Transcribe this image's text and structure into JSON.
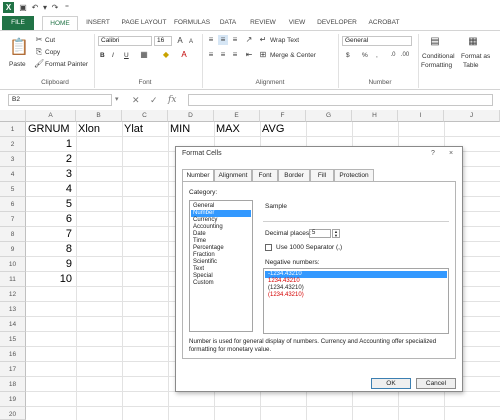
{
  "titlebar": {
    "app_icon": "X",
    "save_icon": "save-icon",
    "undo_icon": "undo-icon",
    "redo_icon": "redo-icon"
  },
  "ribbon_tabs": [
    "FILE",
    "HOME",
    "INSERT",
    "PAGE LAYOUT",
    "FORMULAS",
    "DATA",
    "REVIEW",
    "VIEW",
    "DEVELOPER",
    "ACROBAT"
  ],
  "ribbon": {
    "clipboard": {
      "paste": "Paste",
      "cut": "Cut",
      "copy": "Copy",
      "format_painter": "Format Painter",
      "label": "Clipboard"
    },
    "font": {
      "name": "Calibri",
      "size": "16",
      "bold": "B",
      "italic": "I",
      "underline": "U",
      "label": "Font"
    },
    "alignment": {
      "wrap_text": "Wrap Text",
      "merge_center": "Merge & Center",
      "label": "Alignment"
    },
    "number": {
      "format": "General",
      "currency": "$",
      "percent": "%",
      "comma": ",",
      "label": "Number"
    },
    "styles": {
      "conditional": "Conditional",
      "formatting": "Formatting",
      "format_as": "Format as",
      "table": "Table"
    }
  },
  "formula_bar": {
    "name_box": "B2",
    "fx": "fx",
    "value": ""
  },
  "columns": [
    "A",
    "B",
    "C",
    "D",
    "E",
    "F",
    "G",
    "H",
    "I",
    "J"
  ],
  "rows": [
    "1",
    "2",
    "3",
    "4",
    "5",
    "6",
    "7",
    "8",
    "9",
    "10",
    "11",
    "12",
    "13",
    "14",
    "15",
    "16",
    "17",
    "18",
    "19",
    "20"
  ],
  "headers": [
    "GRNUM",
    "Xlon",
    "Ylat",
    "MIN",
    "MAX",
    "AVG"
  ],
  "grnum_values": [
    "1",
    "2",
    "3",
    "4",
    "5",
    "6",
    "7",
    "8",
    "9",
    "10"
  ],
  "dialog": {
    "title": "Format Cells",
    "help": "?",
    "close": "×",
    "tabs": [
      "Number",
      "Alignment",
      "Font",
      "Border",
      "Fill",
      "Protection"
    ],
    "category_label": "Category:",
    "categories": [
      "General",
      "Number",
      "Currency",
      "Accounting",
      "Date",
      "Time",
      "Percentage",
      "Fraction",
      "Scientific",
      "Text",
      "Special",
      "Custom"
    ],
    "selected_category": "Number",
    "sample_label": "Sample",
    "decimal_label": "Decimal places:",
    "decimal_value": "5",
    "separator_label": "Use 1000 Separator (,)",
    "negative_label": "Negative numbers:",
    "negative_options": [
      "-1234.43210",
      "1234.43210",
      "(1234.43210)",
      "(1234.43210)"
    ],
    "negative_colors": [
      "#ffffff",
      "#d40000",
      "#222222",
      "#d40000"
    ],
    "description": "Number is used for general display of numbers.  Currency and Accounting offer specialized formatting for monetary value.",
    "ok": "OK",
    "cancel": "Cancel"
  },
  "colors": {
    "excel_green": "#217346",
    "selection": "#3399ff",
    "negative_red": "#d40000"
  }
}
